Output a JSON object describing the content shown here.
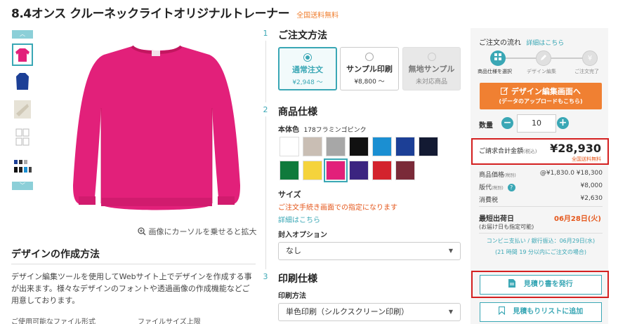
{
  "title": "8.4オンス クルーネックライトオリジナルトレーナー",
  "title_badge": "全国送料無料",
  "gallery": {
    "up": "︿",
    "down": "﹀",
    "zoom_hint": "画像にカーソルを乗せると拡大"
  },
  "design_section": {
    "heading": "デザインの作成方法",
    "body": "デザイン編集ツールを使用してWebサイト上でデザインを作成する事が出来ます。様々なデザインのフォントや透過画像の作成機能などご用意しております。",
    "file_formats_label": "ご使用可能なファイル形式",
    "file_size_label": "ファイルサイズ上限"
  },
  "steps": {
    "s1": "1",
    "s2": "2",
    "s3": "3"
  },
  "order_method": {
    "heading": "ご注文方法",
    "options": [
      {
        "label": "通常注文",
        "price": "¥2,948 〜"
      },
      {
        "label": "サンプル印刷",
        "price": "¥8,800 〜"
      },
      {
        "label": "無地サンプル",
        "price": "未対応商品"
      }
    ]
  },
  "spec": {
    "heading": "商品仕様",
    "body_color_label": "本体色",
    "body_color_value": "178フラミンゴピンク",
    "colors": [
      "#ffffff",
      "#c9beb4",
      "#a7a7a7",
      "#111111",
      "#1b8fd2",
      "#1c3f96",
      "#131a33",
      "#0f7a3c",
      "#f5d33c",
      "#e2207a",
      "#3b2480",
      "#d3232d",
      "#7a2a38"
    ],
    "size_label": "サイズ",
    "size_note": "ご注文手続き画面での指定になります",
    "size_link": "詳細はこちら",
    "packing_label": "封入オプション",
    "packing_value": "なし"
  },
  "print": {
    "heading": "印刷仕様",
    "method_label": "印刷方法",
    "method_value": "単色印刷（シルクスクリーン印刷）"
  },
  "sidebar": {
    "flow_label": "ご注文の流れ",
    "flow_link": "詳細はこちら",
    "flow_steps": [
      "商品仕様を選択",
      "デザイン編集",
      "ご注文完了"
    ],
    "edit_btn_main": "デザイン編集画面へ",
    "edit_btn_sub": "(データのアップロードもこちら)",
    "qty_label": "数量",
    "qty_value": "10",
    "qty_minus": "−",
    "qty_plus": "+",
    "total_label": "ご請求合計金額",
    "total_tax": "(税込)",
    "total_value": "¥28,930",
    "total_ship": "全国送料無料",
    "price_label": "商品価格",
    "price_tax": "(税別)",
    "price_value": "@¥1,830.0 ¥18,300",
    "plate_label": "版代",
    "plate_tax": "(税別)",
    "plate_value": "¥8,000",
    "help": "?",
    "tax_label": "消費税",
    "tax_value": "¥2,630",
    "ship_label": "最短出荷日",
    "ship_sub": "(お届け日も指定可能)",
    "ship_value": "06月28日(火)",
    "conv_text": "コンビニ支払い / 銀行振込：06月29日(水)",
    "conv_note": "(21 時間 19 分以内にご注文の場合)",
    "quote_btn": "見積り書を発行",
    "list_btn": "見積もりリストに追加"
  },
  "colors": {
    "accent": "#3aa7b5",
    "orange": "#f08032",
    "red": "#d42020",
    "sweater": "#e2207a"
  }
}
